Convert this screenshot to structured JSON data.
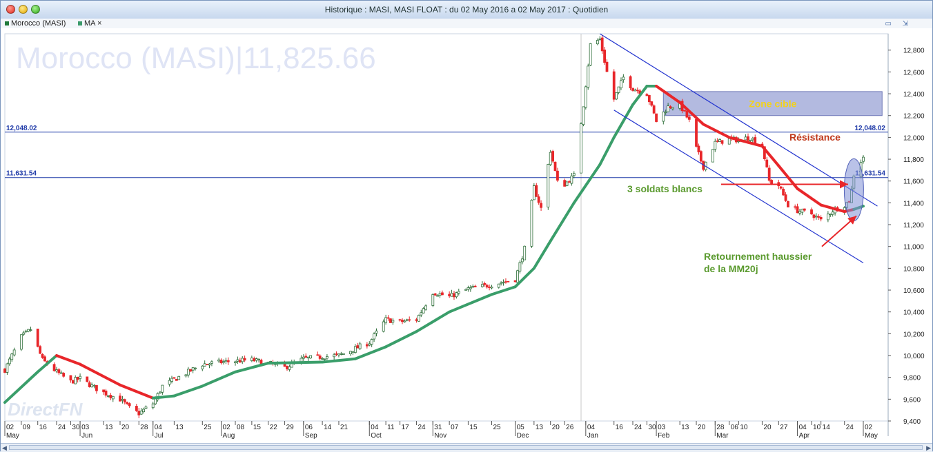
{
  "window": {
    "title": "Historique : MASI, MASI FLOAT : du 02 May 2016 a 02 May 2017 : Quotidien",
    "controls": [
      "close",
      "minimize",
      "maximize"
    ],
    "corner_icons": [
      "restore-icon",
      "expand-icon"
    ]
  },
  "legend": {
    "items": [
      {
        "label": "Morocco (MASI)",
        "color": "#1f7a3a"
      },
      {
        "label": "MA ×",
        "color": "#3a9a6a"
      }
    ]
  },
  "watermark": {
    "instrument": "Morocco (MASI)",
    "separator": "|",
    "last_value": "11,825.66",
    "brand": "DirectFN"
  },
  "colors": {
    "up_candle": "#2f6f3a",
    "down_candle": "#e8262a",
    "ma_rising": "#3a9e6a",
    "ma_falling": "#e8262a",
    "channel": "#2637d0",
    "hline": "#1f3aa8",
    "zone_fill": "#9aa3d6",
    "annotation_green": "#5a9a2e",
    "annotation_red": "#c0391b",
    "zone_text": "#f2d21a"
  },
  "chart_data": {
    "type": "candlestick",
    "title": "",
    "x_range": [
      "2016-05-02",
      "2017-05-02"
    ],
    "ylim": [
      9400,
      12950
    ],
    "y_ticks": [
      9400,
      9600,
      9800,
      10000,
      10200,
      10400,
      10600,
      10800,
      11000,
      11200,
      11400,
      11600,
      11800,
      12000,
      12200,
      12400,
      12600,
      12800
    ],
    "y_tick_labels": [
      "9,400",
      "9,600",
      "9,800",
      "10,000",
      "10,200",
      "10,400",
      "10,600",
      "10,800",
      "11,000",
      "11,200",
      "11,400",
      "11,600",
      "11,800",
      "12,000",
      "12,200",
      "12,400",
      "12,600",
      "12,800"
    ],
    "x_ticks": [
      {
        "date": "2016-05-02",
        "day": "02",
        "month": "May"
      },
      {
        "date": "2016-05-09",
        "day": "09"
      },
      {
        "date": "2016-05-16",
        "day": "16"
      },
      {
        "date": "2016-05-24",
        "day": "24"
      },
      {
        "date": "2016-05-30",
        "day": "30"
      },
      {
        "date": "2016-06-03",
        "day": "03",
        "month": "Jun"
      },
      {
        "date": "2016-06-13",
        "day": "13"
      },
      {
        "date": "2016-06-20",
        "day": "20"
      },
      {
        "date": "2016-06-28",
        "day": "28"
      },
      {
        "date": "2016-07-04",
        "day": "04",
        "month": "Jul"
      },
      {
        "date": "2016-07-13",
        "day": "13"
      },
      {
        "date": "2016-07-25",
        "day": "25"
      },
      {
        "date": "2016-08-02",
        "day": "02",
        "month": "Aug"
      },
      {
        "date": "2016-08-08",
        "day": "08"
      },
      {
        "date": "2016-08-15",
        "day": "15"
      },
      {
        "date": "2016-08-22",
        "day": "22"
      },
      {
        "date": "2016-08-29",
        "day": "29"
      },
      {
        "date": "2016-09-06",
        "day": "06",
        "month": "Sep"
      },
      {
        "date": "2016-09-14",
        "day": "14"
      },
      {
        "date": "2016-09-21",
        "day": "21"
      },
      {
        "date": "2016-10-04",
        "day": "04",
        "month": "Oct"
      },
      {
        "date": "2016-10-11",
        "day": "11"
      },
      {
        "date": "2016-10-17",
        "day": "17"
      },
      {
        "date": "2016-10-24",
        "day": "24"
      },
      {
        "date": "2016-10-31",
        "day": "31",
        "month": "Nov"
      },
      {
        "date": "2016-11-07",
        "day": "07"
      },
      {
        "date": "2016-11-15",
        "day": "15"
      },
      {
        "date": "2016-11-25",
        "day": "25"
      },
      {
        "date": "2016-12-05",
        "day": "05",
        "month": "Dec"
      },
      {
        "date": "2016-12-13",
        "day": "13"
      },
      {
        "date": "2016-12-20",
        "day": "20"
      },
      {
        "date": "2016-12-26",
        "day": "26"
      },
      {
        "date": "2017-01-04",
        "day": "04",
        "month": "Jan"
      },
      {
        "date": "2017-01-16",
        "day": "16"
      },
      {
        "date": "2017-01-24",
        "day": "24"
      },
      {
        "date": "2017-01-30",
        "day": "30"
      },
      {
        "date": "2017-02-03",
        "day": "03",
        "month": "Feb"
      },
      {
        "date": "2017-02-13",
        "day": "13"
      },
      {
        "date": "2017-02-20",
        "day": "20"
      },
      {
        "date": "2017-02-28",
        "day": "28",
        "month": "Mar"
      },
      {
        "date": "2017-03-06",
        "day": "06"
      },
      {
        "date": "2017-03-10",
        "day": "10"
      },
      {
        "date": "2017-03-20",
        "day": "20"
      },
      {
        "date": "2017-03-27",
        "day": "27"
      },
      {
        "date": "2017-04-04",
        "day": "04",
        "month": "Apr"
      },
      {
        "date": "2017-04-10",
        "day": "10"
      },
      {
        "date": "2017-04-14",
        "day": "14"
      },
      {
        "date": "2017-04-24",
        "day": "24"
      },
      {
        "date": "2017-05-02",
        "day": "02",
        "month": "May"
      }
    ],
    "close_anchors": [
      {
        "date": "2016-05-02",
        "v": 9870
      },
      {
        "date": "2016-05-09",
        "v": 10170
      },
      {
        "date": "2016-05-13",
        "v": 10240
      },
      {
        "date": "2016-05-18",
        "v": 9960
      },
      {
        "date": "2016-05-24",
        "v": 9850
      },
      {
        "date": "2016-05-30",
        "v": 9760
      },
      {
        "date": "2016-06-03",
        "v": 9790
      },
      {
        "date": "2016-06-08",
        "v": 9720
      },
      {
        "date": "2016-06-13",
        "v": 9660
      },
      {
        "date": "2016-06-20",
        "v": 9600
      },
      {
        "date": "2016-06-24",
        "v": 9520
      },
      {
        "date": "2016-06-28",
        "v": 9470
      },
      {
        "date": "2016-07-04",
        "v": 9560
      },
      {
        "date": "2016-07-08",
        "v": 9720
      },
      {
        "date": "2016-07-13",
        "v": 9780
      },
      {
        "date": "2016-07-25",
        "v": 9920
      },
      {
        "date": "2016-08-02",
        "v": 9940
      },
      {
        "date": "2016-08-08",
        "v": 9950
      },
      {
        "date": "2016-08-15",
        "v": 9960
      },
      {
        "date": "2016-08-22",
        "v": 9930
      },
      {
        "date": "2016-08-29",
        "v": 9890
      },
      {
        "date": "2016-09-06",
        "v": 9970
      },
      {
        "date": "2016-09-14",
        "v": 9990
      },
      {
        "date": "2016-09-21",
        "v": 10000
      },
      {
        "date": "2016-10-04",
        "v": 10120
      },
      {
        "date": "2016-10-11",
        "v": 10330
      },
      {
        "date": "2016-10-17",
        "v": 10310
      },
      {
        "date": "2016-10-24",
        "v": 10330
      },
      {
        "date": "2016-10-31",
        "v": 10580
      },
      {
        "date": "2016-11-07",
        "v": 10540
      },
      {
        "date": "2016-11-15",
        "v": 10610
      },
      {
        "date": "2016-11-25",
        "v": 10650
      },
      {
        "date": "2016-12-05",
        "v": 10700
      },
      {
        "date": "2016-12-09",
        "v": 10980
      },
      {
        "date": "2016-12-13",
        "v": 11540
      },
      {
        "date": "2016-12-16",
        "v": 11350
      },
      {
        "date": "2016-12-20",
        "v": 11880
      },
      {
        "date": "2016-12-23",
        "v": 11590
      },
      {
        "date": "2016-12-26",
        "v": 11570
      },
      {
        "date": "2016-12-30",
        "v": 11650
      },
      {
        "date": "2017-01-03",
        "v": 12300
      },
      {
        "date": "2017-01-06",
        "v": 12850
      },
      {
        "date": "2017-01-10",
        "v": 12900
      },
      {
        "date": "2017-01-13",
        "v": 12600
      },
      {
        "date": "2017-01-16",
        "v": 12350
      },
      {
        "date": "2017-01-20",
        "v": 12550
      },
      {
        "date": "2017-01-24",
        "v": 12450
      },
      {
        "date": "2017-01-30",
        "v": 12400
      },
      {
        "date": "2017-02-03",
        "v": 12150
      },
      {
        "date": "2017-02-08",
        "v": 12280
      },
      {
        "date": "2017-02-13",
        "v": 12300
      },
      {
        "date": "2017-02-17",
        "v": 12150
      },
      {
        "date": "2017-02-20",
        "v": 11900
      },
      {
        "date": "2017-02-23",
        "v": 11730
      },
      {
        "date": "2017-02-28",
        "v": 11950
      },
      {
        "date": "2017-03-06",
        "v": 11980
      },
      {
        "date": "2017-03-10",
        "v": 11980
      },
      {
        "date": "2017-03-15",
        "v": 12000
      },
      {
        "date": "2017-03-20",
        "v": 11920
      },
      {
        "date": "2017-03-23",
        "v": 11600
      },
      {
        "date": "2017-03-27",
        "v": 11560
      },
      {
        "date": "2017-03-31",
        "v": 11380
      },
      {
        "date": "2017-04-04",
        "v": 11330
      },
      {
        "date": "2017-04-10",
        "v": 11300
      },
      {
        "date": "2017-04-14",
        "v": 11240
      },
      {
        "date": "2017-04-19",
        "v": 11330
      },
      {
        "date": "2017-04-24",
        "v": 11380
      },
      {
        "date": "2017-04-26",
        "v": 11420
      },
      {
        "date": "2017-04-27",
        "v": 11520
      },
      {
        "date": "2017-04-28",
        "v": 11660
      },
      {
        "date": "2017-05-02",
        "v": 11825
      }
    ],
    "ma": {
      "name": "MA",
      "period_days": 20,
      "points": [
        {
          "date": "2016-05-02",
          "v": 9570
        },
        {
          "date": "2016-05-16",
          "v": 9850
        },
        {
          "date": "2016-05-24",
          "v": 10000
        },
        {
          "date": "2016-06-03",
          "v": 9920
        },
        {
          "date": "2016-06-20",
          "v": 9730
        },
        {
          "date": "2016-07-04",
          "v": 9610
        },
        {
          "date": "2016-07-13",
          "v": 9630
        },
        {
          "date": "2016-07-25",
          "v": 9720
        },
        {
          "date": "2016-08-08",
          "v": 9850
        },
        {
          "date": "2016-08-22",
          "v": 9930
        },
        {
          "date": "2016-09-14",
          "v": 9940
        },
        {
          "date": "2016-09-28",
          "v": 9970
        },
        {
          "date": "2016-10-11",
          "v": 10080
        },
        {
          "date": "2016-10-24",
          "v": 10220
        },
        {
          "date": "2016-11-07",
          "v": 10400
        },
        {
          "date": "2016-11-25",
          "v": 10560
        },
        {
          "date": "2016-12-05",
          "v": 10630
        },
        {
          "date": "2016-12-13",
          "v": 10800
        },
        {
          "date": "2016-12-20",
          "v": 11050
        },
        {
          "date": "2016-12-30",
          "v": 11400
        },
        {
          "date": "2017-01-10",
          "v": 11750
        },
        {
          "date": "2017-01-16",
          "v": 12000
        },
        {
          "date": "2017-01-24",
          "v": 12300
        },
        {
          "date": "2017-01-30",
          "v": 12470
        },
        {
          "date": "2017-02-03",
          "v": 12470
        },
        {
          "date": "2017-02-13",
          "v": 12320
        },
        {
          "date": "2017-02-23",
          "v": 12120
        },
        {
          "date": "2017-03-06",
          "v": 12000
        },
        {
          "date": "2017-03-20",
          "v": 11920
        },
        {
          "date": "2017-03-27",
          "v": 11740
        },
        {
          "date": "2017-04-04",
          "v": 11530
        },
        {
          "date": "2017-04-14",
          "v": 11380
        },
        {
          "date": "2017-04-24",
          "v": 11320
        },
        {
          "date": "2017-04-28",
          "v": 11340
        },
        {
          "date": "2017-05-02",
          "v": 11370
        }
      ],
      "falling_segments": [
        [
          "2016-05-24",
          "2016-07-04"
        ],
        [
          "2017-02-03",
          "2017-04-26"
        ]
      ]
    },
    "horizontal_lines": [
      {
        "value": 12048.02,
        "label": "12,048.02"
      },
      {
        "value": 11631.54,
        "label": "11,631.54"
      }
    ],
    "channel": {
      "upper": [
        {
          "date": "2017-01-10",
          "v": 12950
        },
        {
          "date": "2017-05-08",
          "v": 11370
        }
      ],
      "lower": [
        {
          "date": "2017-01-16",
          "v": 12250
        },
        {
          "date": "2017-05-02",
          "v": 10850
        }
      ]
    },
    "zone": {
      "label": "Zone cible",
      "x": [
        "2017-02-06",
        "2017-05-10"
      ],
      "y": [
        12200,
        12420
      ]
    },
    "annotations": [
      {
        "text": "Résistance",
        "kind": "red"
      },
      {
        "text": "3 soldats blancs",
        "kind": "green"
      },
      {
        "text": "Retournement haussier",
        "kind": "green"
      },
      {
        "text": "de la MM20j",
        "kind": "green"
      }
    ],
    "vertical_marker": "2017-01-02"
  }
}
